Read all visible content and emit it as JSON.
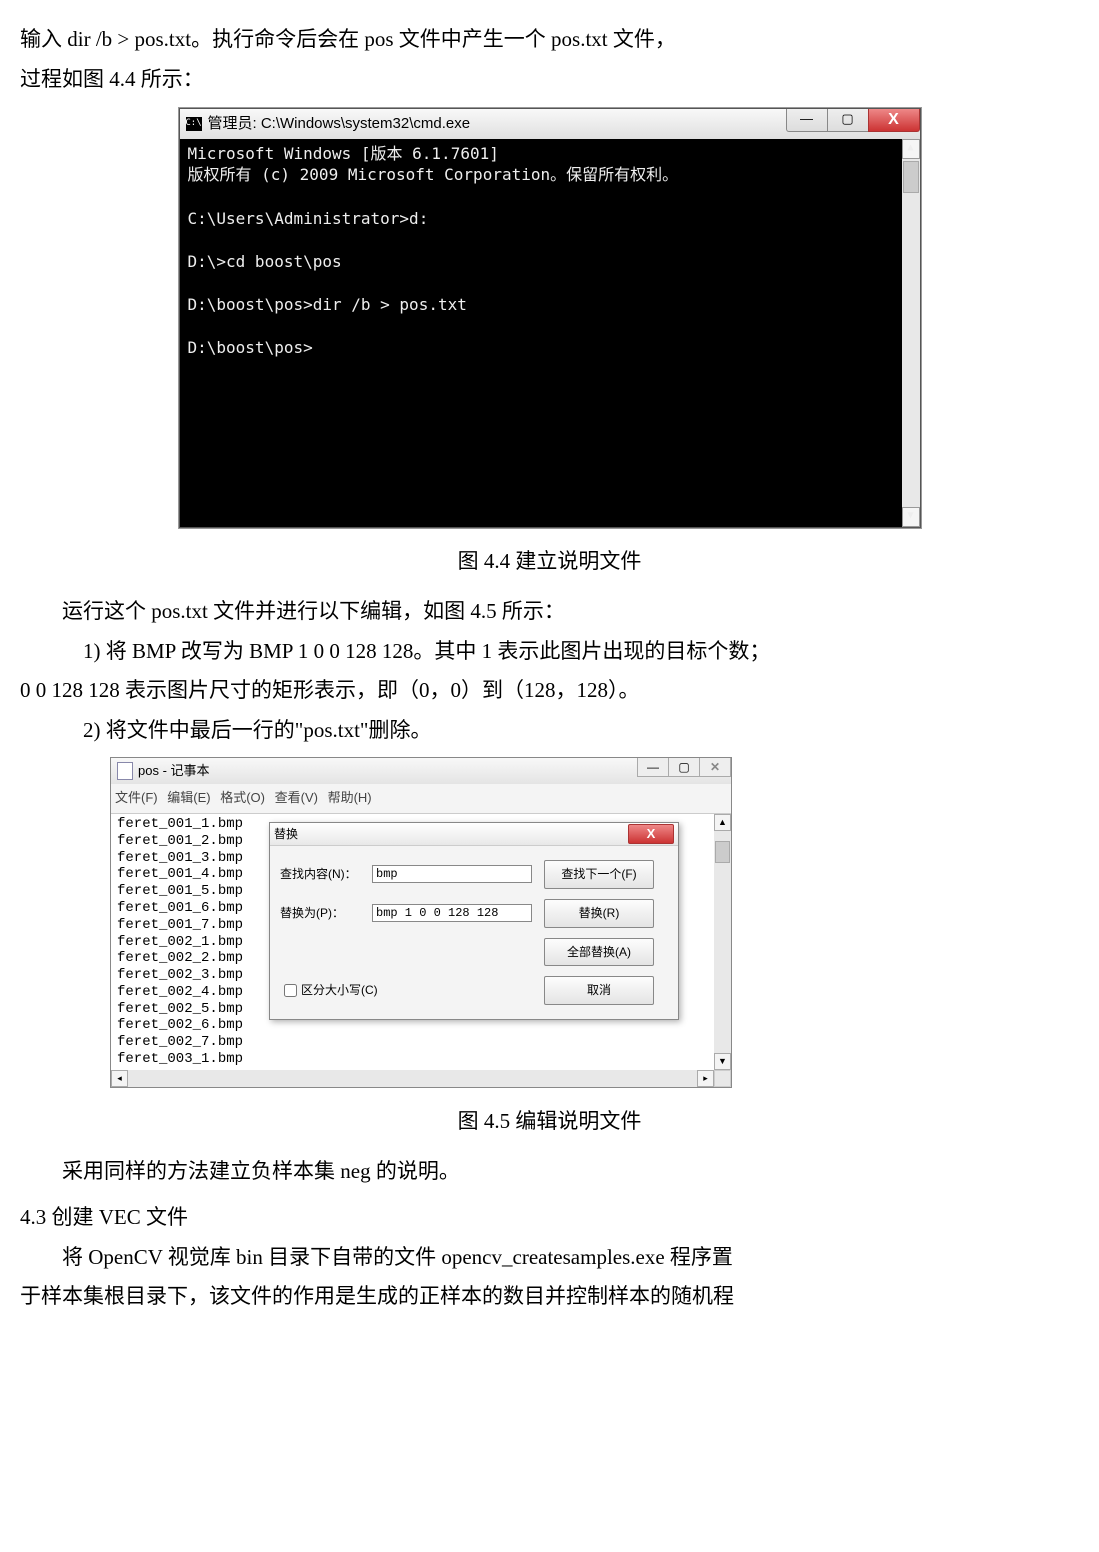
{
  "doc": {
    "line1": "输入 dir /b > pos.txt。执行命令后会在 pos 文件中产生一个 pos.txt 文件，",
    "line2": "过程如图 4.4 所示：",
    "fig44_caption": "图 4.4  建立说明文件",
    "line3": "运行这个 pos.txt 文件并进行以下编辑，如图 4.5 所示：",
    "line4": "1) 将 BMP 改写为 BMP 1 0 0 128 128。其中 1 表示此图片出现的目标个数；",
    "line5": "0 0 128 128 表示图片尺寸的矩形表示，即（0，0）到（128，128）。",
    "line6": "2) 将文件中最后一行的\"pos.txt\"删除。",
    "fig45_caption": "图 4.5  编辑说明文件",
    "line7": "采用同样的方法建立负样本集 neg 的说明。",
    "sec43": "4.3  创建 VEC 文件",
    "line8": "将 OpenCV 视觉库 bin 目录下自带的文件 opencv_createsamples.exe 程序置",
    "line9": "于样本集根目录下，该文件的作用是生成的正样本的数目并控制样本的随机程"
  },
  "cmd": {
    "title": "管理员: C:\\Windows\\system32\\cmd.exe",
    "icon_text": "C:\\",
    "content": "Microsoft Windows [版本 6.1.7601]\n版权所有 (c) 2009 Microsoft Corporation。保留所有权利。\n\nC:\\Users\\Administrator>d:\n\nD:\\>cd boost\\pos\n\nD:\\boost\\pos>dir /b > pos.txt\n\nD:\\boost\\pos>",
    "min": "—",
    "max": "▢",
    "close": "X"
  },
  "notepad": {
    "title": "pos - 记事本",
    "menu": {
      "file": "文件(F)",
      "edit": "编辑(E)",
      "format": "格式(O)",
      "view": "查看(V)",
      "help": "帮助(H)"
    },
    "files": "feret_001_1.bmp\nferet_001_2.bmp\nferet_001_3.bmp\nferet_001_4.bmp\nferet_001_5.bmp\nferet_001_6.bmp\nferet_001_7.bmp\nferet_002_1.bmp\nferet_002_2.bmp\nferet_002_3.bmp\nferet_002_4.bmp\nferet_002_5.bmp\nferet_002_6.bmp\nferet_002_7.bmp\nferet_003_1.bmp",
    "min": "—",
    "max": "▢",
    "close": "✕"
  },
  "replace": {
    "title": "替换",
    "find_label": "查找内容(N)：",
    "find_value": "bmp",
    "repl_label": "替换为(P)：",
    "repl_value": "bmp 1 0 0 128 128",
    "case_label": "区分大小写(C)",
    "btn_findnext": "查找下一个(F)",
    "btn_replace": "替换(R)",
    "btn_replaceall": "全部替换(A)",
    "btn_cancel": "取消",
    "close": "X"
  }
}
